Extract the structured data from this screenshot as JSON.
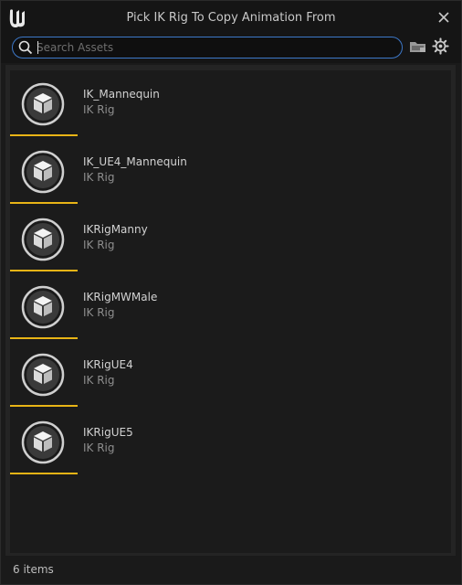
{
  "window": {
    "title": "Pick IK Rig To Copy Animation From"
  },
  "search": {
    "placeholder": "Search Assets",
    "value": ""
  },
  "toolbar": {
    "icons": [
      "folder-icon",
      "gear-icon"
    ]
  },
  "assets": [
    {
      "name": "IK_Mannequin",
      "type": "IK Rig"
    },
    {
      "name": "IK_UE4_Mannequin",
      "type": "IK Rig"
    },
    {
      "name": "IKRigManny",
      "type": "IK Rig"
    },
    {
      "name": "IKRigMWMale",
      "type": "IK Rig"
    },
    {
      "name": "IKRigUE4",
      "type": "IK Rig"
    },
    {
      "name": "IKRigUE5",
      "type": "IK Rig"
    }
  ],
  "status": {
    "item_count": "6 items"
  },
  "colors": {
    "accent_underline": "#e8b416",
    "search_border": "#3d78c8",
    "background": "#1a1a1a"
  }
}
